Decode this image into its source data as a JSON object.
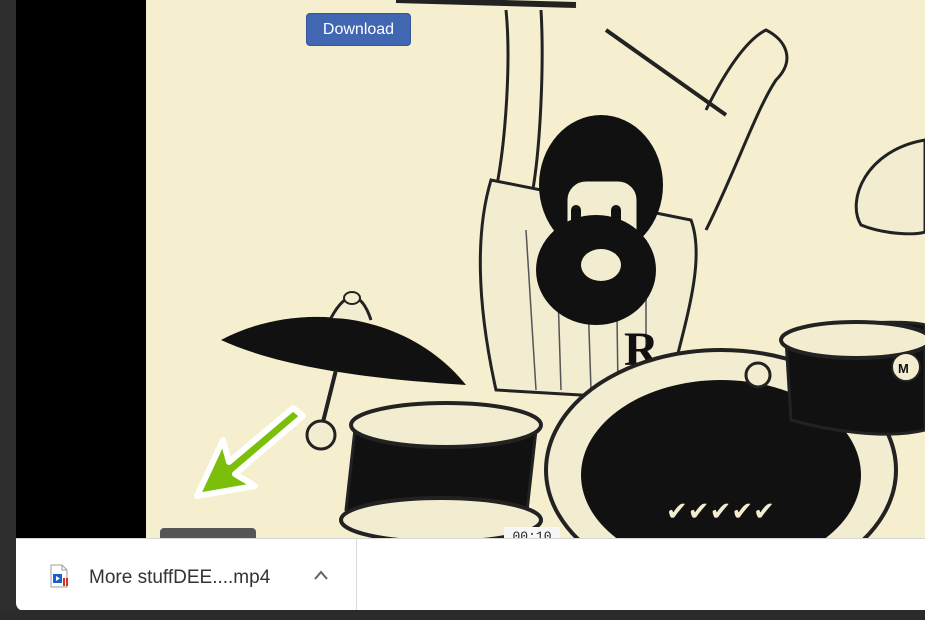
{
  "video": {
    "download_label": "Download",
    "timestamp": "00:10"
  },
  "download_shelf": {
    "file_name": "More stuffDEE....mp4",
    "file_icon": "video-file-icon",
    "menu_icon": "chevron-up-icon"
  },
  "colors": {
    "download_button": "#4267b2",
    "arrow": "#7cbf0a",
    "video_background": "#f5efcf"
  }
}
